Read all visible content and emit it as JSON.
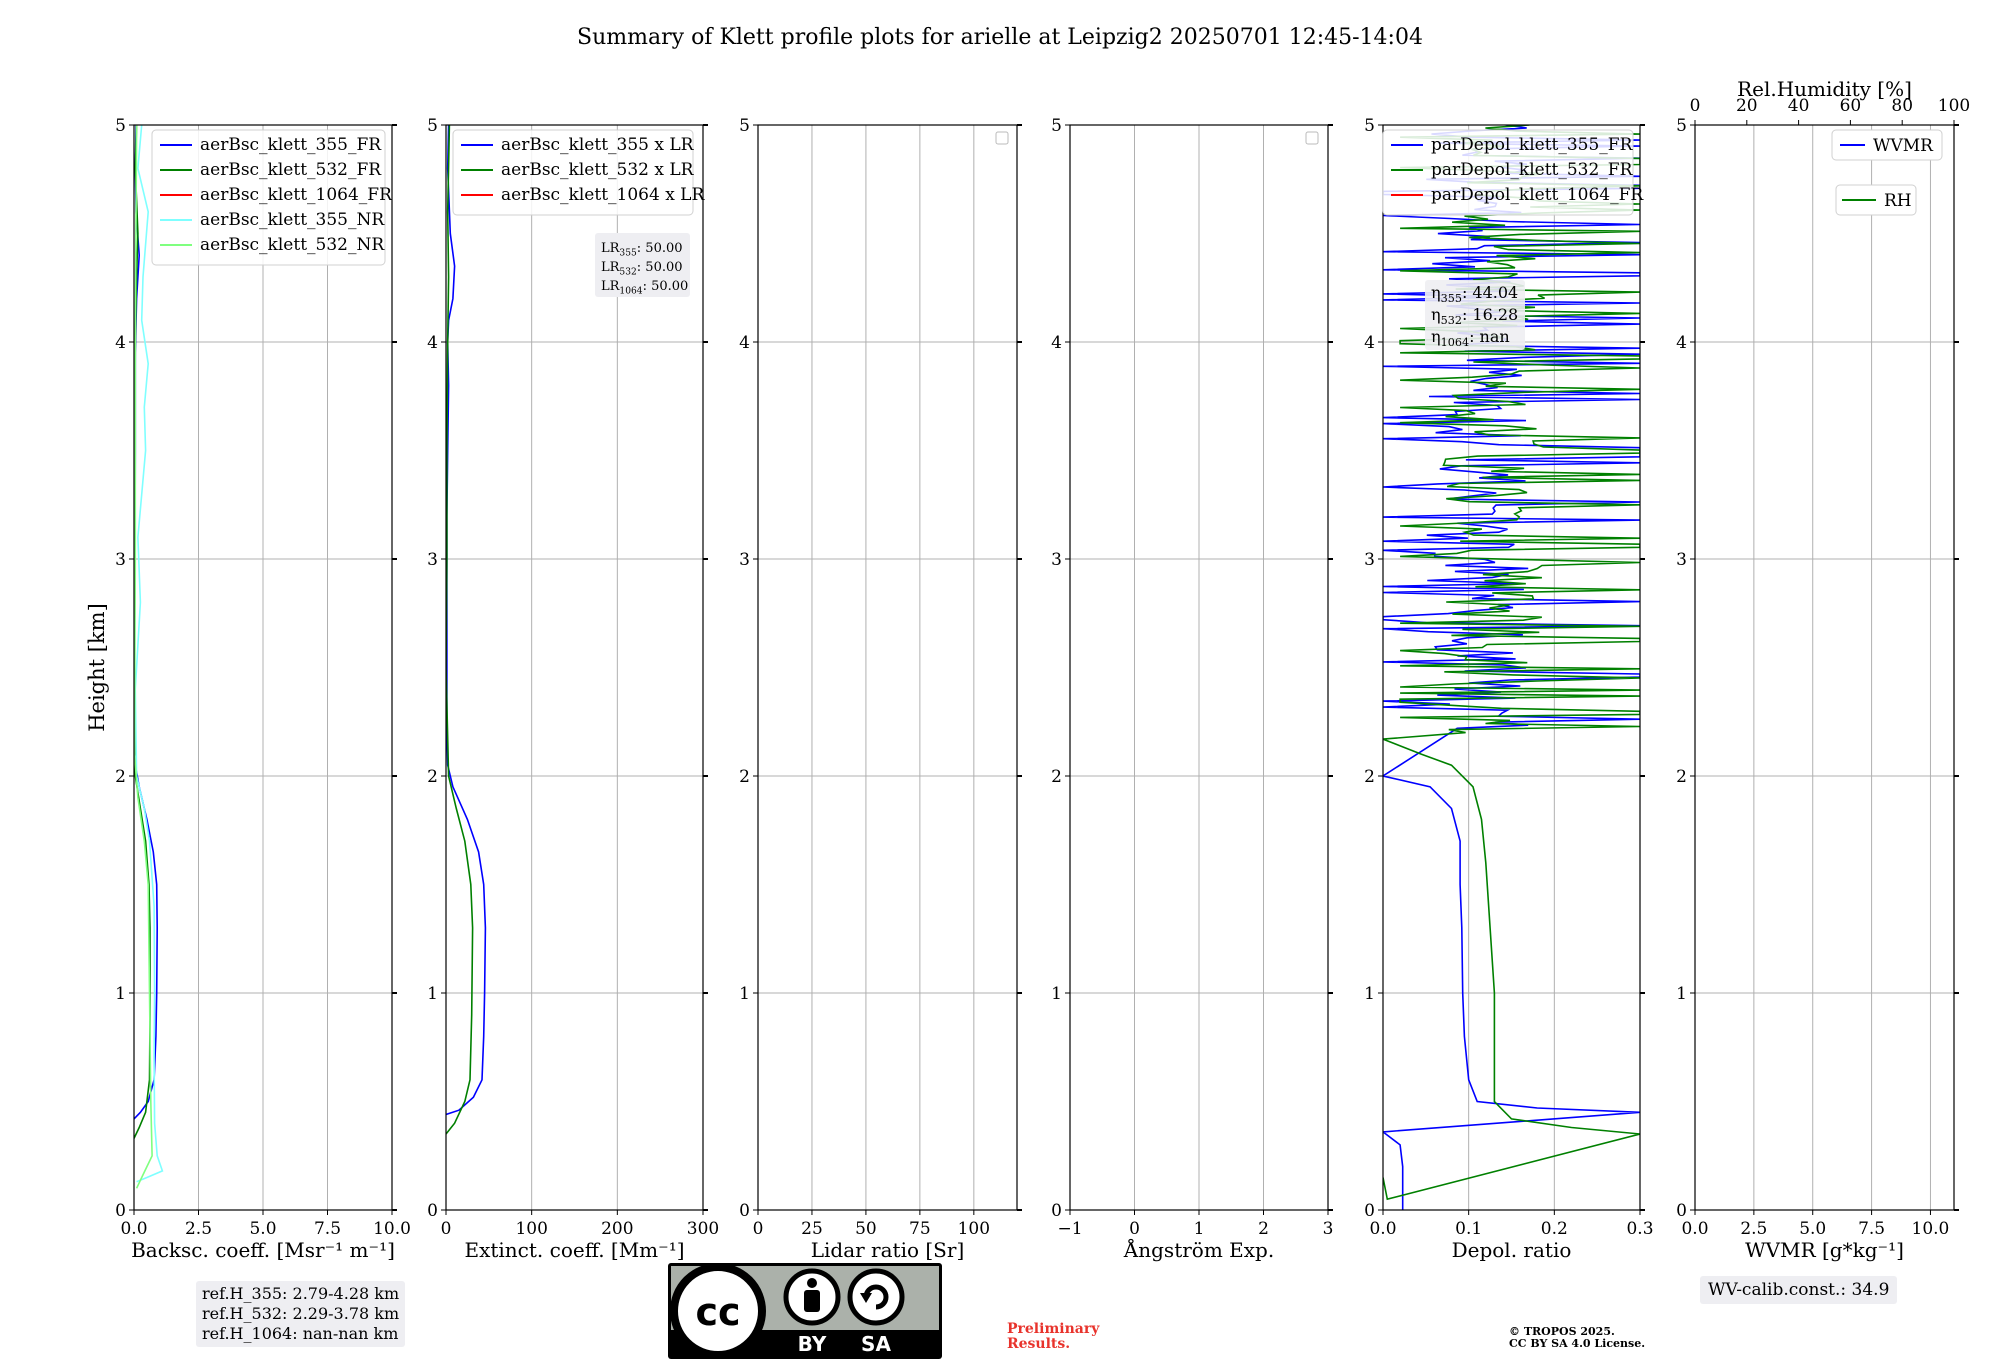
{
  "title": "Summary of Klett profile plots for arielle at Leipzig2 20250701 12:45-14:04",
  "colors": {
    "blue": "#0000ff",
    "green": "#008000",
    "red": "#ff0000",
    "cyan": "#7fffff",
    "lightgreen": "#7fff7f",
    "grid": "#b0b0b0",
    "textbox_bg": "#eeeef2",
    "prelim": "#e8332c"
  },
  "chart_data": [
    {
      "type": "line",
      "xlabel": "Backsc. coeff. [Msr⁻¹ m⁻¹]",
      "ylabel": "Height [km]",
      "xlim": [
        0,
        10
      ],
      "ylim": [
        0,
        5
      ],
      "xticks": [
        "0.0",
        "2.5",
        "5.0",
        "7.5",
        "10.0"
      ],
      "yticks": [
        "0",
        "1",
        "2",
        "3",
        "4",
        "5"
      ],
      "grid": true,
      "legend_position": "upper-right",
      "series": [
        {
          "name": "aerBsc_klett_355_FR",
          "color": "#0000ff",
          "points": [
            [
              0,
              0.42
            ],
            [
              0.25,
              0.45
            ],
            [
              0.55,
              0.5
            ],
            [
              0.78,
              0.6
            ],
            [
              0.85,
              0.8
            ],
            [
              0.88,
              1.0
            ],
            [
              0.9,
              1.3
            ],
            [
              0.88,
              1.5
            ],
            [
              0.75,
              1.65
            ],
            [
              0.5,
              1.8
            ],
            [
              0.2,
              1.95
            ],
            [
              0.05,
              2.05
            ],
            [
              0.02,
              2.5
            ],
            [
              0.04,
              3.0
            ],
            [
              0.05,
              3.5
            ],
            [
              0.05,
              3.95
            ],
            [
              0.1,
              4.2
            ],
            [
              0.2,
              4.4
            ],
            [
              0.08,
              4.6
            ],
            [
              0.05,
              4.8
            ],
            [
              0.08,
              5.0
            ]
          ]
        },
        {
          "name": "aerBsc_klett_532_FR",
          "color": "#008000",
          "points": [
            [
              0,
              0.33
            ],
            [
              0.2,
              0.38
            ],
            [
              0.45,
              0.45
            ],
            [
              0.6,
              0.6
            ],
            [
              0.62,
              0.9
            ],
            [
              0.62,
              1.3
            ],
            [
              0.58,
              1.5
            ],
            [
              0.45,
              1.7
            ],
            [
              0.25,
              1.85
            ],
            [
              0.05,
              2.0
            ],
            [
              0.0,
              2.5
            ],
            [
              0.02,
              3.0
            ],
            [
              0.03,
              3.5
            ],
            [
              0.05,
              4.0
            ],
            [
              0.1,
              4.3
            ],
            [
              0.15,
              4.5
            ],
            [
              0.05,
              4.8
            ],
            [
              0.1,
              5.0
            ]
          ]
        },
        {
          "name": "aerBsc_klett_1064_FR",
          "color": "#ff0000",
          "points": []
        },
        {
          "name": "aerBsc_klett_355_NR",
          "color": "#7fffff",
          "points": [
            [
              0.1,
              0.13
            ],
            [
              0.5,
              0.15
            ],
            [
              1.1,
              0.18
            ],
            [
              0.9,
              0.25
            ],
            [
              0.8,
              0.4
            ],
            [
              0.78,
              0.7
            ],
            [
              0.8,
              1.0
            ],
            [
              0.78,
              1.4
            ],
            [
              0.6,
              1.7
            ],
            [
              0.4,
              1.85
            ],
            [
              0.1,
              2.0
            ],
            [
              0.05,
              2.4
            ],
            [
              0.25,
              2.8
            ],
            [
              0.15,
              3.1
            ],
            [
              0.45,
              3.5
            ],
            [
              0.4,
              3.7
            ],
            [
              0.55,
              3.9
            ],
            [
              0.3,
              4.1
            ],
            [
              0.35,
              4.3
            ],
            [
              0.55,
              4.6
            ],
            [
              0.15,
              4.8
            ],
            [
              0.3,
              5.0
            ]
          ]
        },
        {
          "name": "aerBsc_klett_532_NR",
          "color": "#7fff7f",
          "points": [
            [
              0.1,
              0.1
            ],
            [
              0.3,
              0.15
            ],
            [
              0.7,
              0.25
            ],
            [
              0.65,
              0.5
            ],
            [
              0.6,
              1.0
            ],
            [
              0.55,
              1.5
            ],
            [
              0.4,
              1.7
            ],
            [
              0.15,
              1.9
            ],
            [
              0.02,
              2.1
            ],
            [
              0.05,
              3.0
            ],
            [
              0.05,
              4.0
            ],
            [
              0.1,
              5.0
            ]
          ]
        }
      ],
      "annotation": [
        "ref.H_355: 2.79-4.28 km",
        "ref.H_532: 2.29-3.78 km",
        "ref.H_1064: nan-nan km"
      ]
    },
    {
      "type": "line",
      "xlabel": "Extinct. coeff. [Mm⁻¹]",
      "xlim": [
        0,
        300
      ],
      "ylim": [
        0,
        5
      ],
      "xticks": [
        "0",
        "100",
        "200",
        "300"
      ],
      "yticks": [
        "0",
        "1",
        "2",
        "3",
        "4",
        "5"
      ],
      "grid": true,
      "legend_position": "upper-right",
      "series": [
        {
          "name": "aerBsc_klett_355 x LR",
          "color": "#0000ff",
          "points": [
            [
              0,
              0.44
            ],
            [
              15,
              0.46
            ],
            [
              32,
              0.52
            ],
            [
              42,
              0.6
            ],
            [
              44,
              0.8
            ],
            [
              45,
              1.0
            ],
            [
              46,
              1.3
            ],
            [
              44,
              1.5
            ],
            [
              38,
              1.65
            ],
            [
              25,
              1.8
            ],
            [
              8,
              1.95
            ],
            [
              2,
              2.05
            ],
            [
              1,
              2.2
            ],
            [
              1,
              3.2
            ],
            [
              2,
              3.5
            ],
            [
              3,
              3.8
            ],
            [
              2,
              4.0
            ],
            [
              3,
              4.1
            ],
            [
              8,
              4.2
            ],
            [
              10,
              4.35
            ],
            [
              5,
              4.5
            ],
            [
              2,
              4.8
            ],
            [
              3,
              5.0
            ]
          ]
        },
        {
          "name": "aerBsc_klett_532 x LR",
          "color": "#008000",
          "points": [
            [
              0,
              0.35
            ],
            [
              10,
              0.4
            ],
            [
              22,
              0.5
            ],
            [
              28,
              0.6
            ],
            [
              30,
              0.9
            ],
            [
              31,
              1.3
            ],
            [
              29,
              1.5
            ],
            [
              22,
              1.7
            ],
            [
              12,
              1.85
            ],
            [
              3,
              2.0
            ],
            [
              0,
              2.5
            ],
            [
              1,
              3.0
            ],
            [
              1,
              3.5
            ],
            [
              2,
              4.0
            ],
            [
              3,
              4.3
            ],
            [
              2,
              4.6
            ],
            [
              4,
              5.0
            ]
          ]
        },
        {
          "name": "aerBsc_klett_1064 x LR",
          "color": "#ff0000",
          "points": []
        }
      ],
      "annotation": [
        "LR355: 50.00",
        "LR532: 50.00",
        "LR1064: 50.00"
      ]
    },
    {
      "type": "line",
      "xlabel": "Lidar ratio [Sr]",
      "xlim": [
        0,
        120
      ],
      "ylim": [
        0,
        5
      ],
      "xticks": [
        "0",
        "25",
        "50",
        "75",
        "100"
      ],
      "yticks": [
        "0",
        "1",
        "2",
        "3",
        "4",
        "5"
      ],
      "grid": true,
      "legend_position": "upper-right",
      "series": []
    },
    {
      "type": "line",
      "xlabel": "Ångström Exp.",
      "xlim": [
        -1,
        3
      ],
      "ylim": [
        0,
        5
      ],
      "xticks": [
        "−1",
        "0",
        "1",
        "2",
        "3"
      ],
      "yticks": [
        "0",
        "1",
        "2",
        "3",
        "4",
        "5"
      ],
      "grid": true,
      "legend_position": "upper-right",
      "series": []
    },
    {
      "type": "line",
      "xlabel": "Depol. ratio",
      "xlim": [
        0,
        0.3
      ],
      "ylim": [
        0,
        5
      ],
      "xticks": [
        "0.0",
        "0.1",
        "0.2",
        "0.3"
      ],
      "yticks": [
        "0",
        "1",
        "2",
        "3",
        "4",
        "5"
      ],
      "grid": true,
      "legend_position": "upper-left",
      "series": [
        {
          "name": "parDepol_klett_355_FR",
          "color": "#0000ff",
          "points": [
            [
              0.023,
              0
            ],
            [
              0.023,
              0.2
            ],
            [
              0.02,
              0.3
            ],
            [
              0.0,
              0.36
            ],
            [
              0.3,
              0.45
            ],
            [
              0.18,
              0.47
            ],
            [
              0.11,
              0.5
            ],
            [
              0.1,
              0.6
            ],
            [
              0.095,
              0.8
            ],
            [
              0.093,
              1.0
            ],
            [
              0.092,
              1.3
            ],
            [
              0.09,
              1.5
            ],
            [
              0.09,
              1.7
            ],
            [
              0.08,
              1.85
            ],
            [
              0.055,
              1.95
            ],
            [
              0.0,
              2.0
            ]
          ],
          "noisy_from": 2.22,
          "noisy_to": 5.0,
          "noise_range": [
            0.0,
            0.3
          ]
        },
        {
          "name": "parDepol_klett_532_FR",
          "color": "#008000",
          "points": [
            [
              0.0,
              0.15
            ],
            [
              0.005,
              0.05
            ],
            [
              0.3,
              0.35
            ],
            [
              0.22,
              0.38
            ],
            [
              0.15,
              0.42
            ],
            [
              0.13,
              0.5
            ],
            [
              0.13,
              0.7
            ],
            [
              0.13,
              1.0
            ],
            [
              0.125,
              1.3
            ],
            [
              0.12,
              1.6
            ],
            [
              0.115,
              1.8
            ],
            [
              0.105,
              1.95
            ],
            [
              0.08,
              2.05
            ],
            [
              0.045,
              2.1
            ],
            [
              0.0,
              2.17
            ]
          ],
          "noisy_from": 2.2,
          "noisy_to": 5.0,
          "noise_range": [
            0.02,
            0.3
          ]
        },
        {
          "name": "parDepol_klett_1064_FR",
          "color": "#ff0000",
          "points": []
        }
      ],
      "annotation": [
        "η355: 44.04",
        "η532: 16.28",
        "η1064: nan"
      ]
    },
    {
      "type": "line",
      "xlabel": "WVMR [g*kg⁻¹]",
      "xlabel_top": "Rel.Humidity [%]",
      "xlim": [
        0,
        11
      ],
      "xlim_top": [
        0,
        100
      ],
      "ylim": [
        0,
        5
      ],
      "xticks": [
        "0.0",
        "2.5",
        "5.0",
        "7.5",
        "10.0"
      ],
      "xticks_top": [
        "0",
        "20",
        "40",
        "60",
        "80",
        "100"
      ],
      "yticks": [
        "0",
        "1",
        "2",
        "3",
        "4",
        "5"
      ],
      "grid": true,
      "series": [
        {
          "name": "WVMR",
          "color": "#0000ff",
          "points": []
        },
        {
          "name": "RH",
          "color": "#008000",
          "points": []
        }
      ],
      "annotation": [
        "WV-calib.const.: 34.9"
      ]
    }
  ],
  "license": {
    "badge_top": "cc",
    "by": "BY",
    "sa": "SA",
    "preliminary": "Preliminary Results.",
    "copyright_line1": "© TROPOS 2025.",
    "copyright_line2": "CC BY SA 4.0 License."
  }
}
